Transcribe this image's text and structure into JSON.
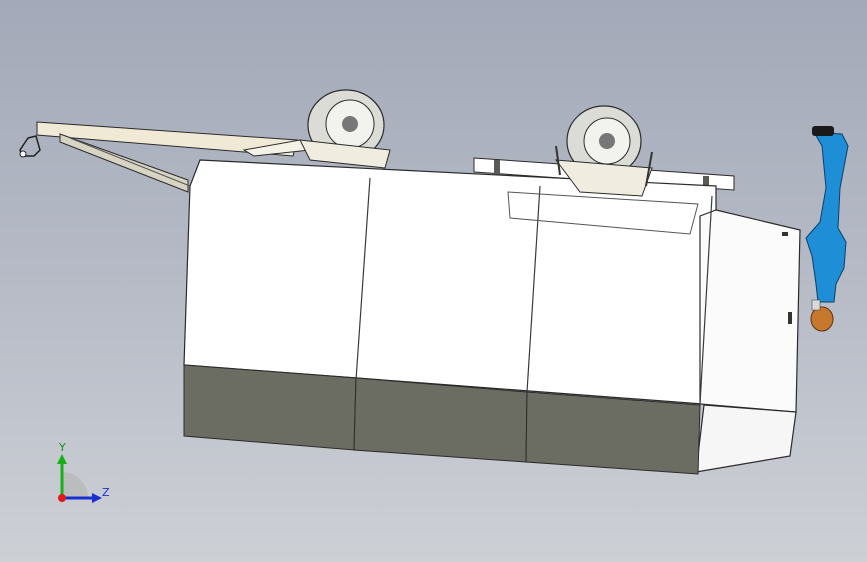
{
  "viewport": {
    "background_top": "#a3a9b8",
    "background_bottom": "#cdd0d5"
  },
  "model": {
    "parts": [
      "trailer-body",
      "lower-skirt",
      "tow-hitch",
      "roof-spare-wheel-front",
      "roof-spare-wheel-rear",
      "roof-rack",
      "mannequin"
    ],
    "colors": {
      "body": "#ffffff",
      "skirt": "#6d6d63",
      "edge": "#2b2b2b",
      "tire": "#d9d9d4",
      "mannequin": "#1e8fd6",
      "head": "#c8782c"
    }
  },
  "triad": {
    "y_label": "Y",
    "z_label": "Z",
    "colors": {
      "y": "#18b018",
      "z": "#1a2fd0",
      "x": "#e01818"
    }
  }
}
